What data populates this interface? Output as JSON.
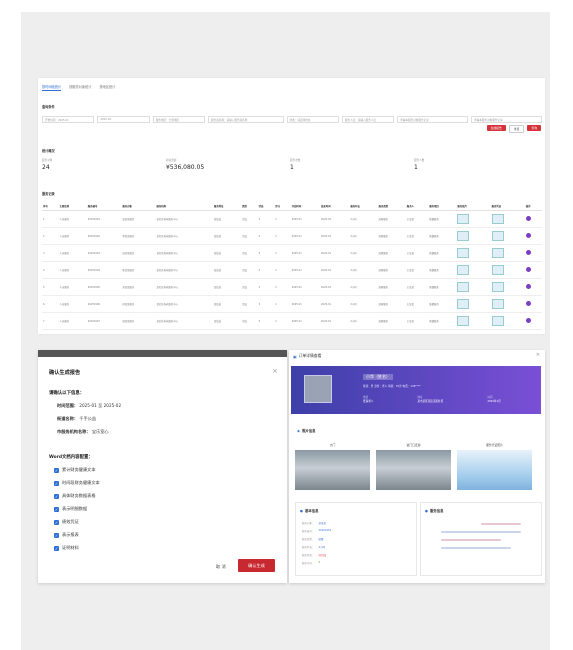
{
  "top_panel": {
    "tabs": [
      "按时间段统计",
      "按服务对象统计",
      "按地区统计"
    ],
    "section_query": "查询条件",
    "filter_fields": [
      "开始时间：2025-01",
      "2025-02",
      "服务地区：全部地区",
      "服务商名称：请输入服务商名称",
      "状态：请选择状态",
      "服务人员：请输入服务人员",
      "查看本服务对象服务记录",
      "查看本服务对象服务记录"
    ],
    "buttons": [
      "生成报告",
      "重置",
      "查询"
    ],
    "section_stats": "统计概况",
    "stats": [
      {
        "key": "服务对象",
        "value": "24"
      },
      {
        "key": "补贴金额",
        "value": "¥536,080.05"
      },
      {
        "key": "服务次数",
        "value": "1"
      },
      {
        "key": "服务人数",
        "value": "1"
      }
    ],
    "section_list": "服务记录",
    "table_headers": [
      "序号",
      "主题名称",
      "服务编号",
      "服务对象",
      "服务机构",
      "服务地址",
      "类型",
      "状态",
      "评分",
      "开始时间",
      "结束时间",
      "服务时长",
      "服务类型",
      "服务人",
      "服务项目",
      "服务照片",
      "服务凭证",
      "操作"
    ],
    "table_rows": [
      [
        "1",
        "人员服务",
        "20250101",
        "张某某服务",
        "某社区养老服务中心",
        "某街道",
        "完成",
        "5",
        "1",
        "2025-01",
        "2025-01",
        "2小时",
        "居家服务",
        "王某某",
        "助餐服务"
      ],
      [
        "2",
        "人员服务",
        "20250102",
        "李某某服务",
        "某社区养老服务中心",
        "某街道",
        "完成",
        "5",
        "1",
        "2025-01",
        "2025-01",
        "2小时",
        "居家服务",
        "王某某",
        "助餐服务"
      ],
      [
        "3",
        "人员服务",
        "20250103",
        "赵某某服务",
        "某社区养老服务中心",
        "某街道",
        "完成",
        "5",
        "1",
        "2025-01",
        "2025-01",
        "2小时",
        "居家服务",
        "王某某",
        "助餐服务"
      ],
      [
        "4",
        "人员服务",
        "20250104",
        "陈某某服务",
        "某社区养老服务中心",
        "某街道",
        "完成",
        "5",
        "1",
        "2025-01",
        "2025-01",
        "2小时",
        "居家服务",
        "王某某",
        "助餐服务"
      ],
      [
        "5",
        "人员服务",
        "20250105",
        "刘某某服务",
        "某社区养老服务中心",
        "某街道",
        "完成",
        "5",
        "1",
        "2025-01",
        "2025-01",
        "2小时",
        "居家服务",
        "王某某",
        "助餐服务"
      ],
      [
        "6",
        "人员服务",
        "20250106",
        "孙某某服务",
        "某社区养老服务中心",
        "某街道",
        "完成",
        "5",
        "1",
        "2025-01",
        "2025-01",
        "2小时",
        "居家服务",
        "王某某",
        "助餐服务"
      ],
      [
        "7",
        "人员服务",
        "20250107",
        "周某某服务",
        "某社区养老服务中心",
        "某街道",
        "完成",
        "5",
        "1",
        "2025-01",
        "2025-01",
        "2小时",
        "居家服务",
        "王某某",
        "助餐服务"
      ]
    ]
  },
  "modal": {
    "title": "确认生成报告",
    "intro": "请确认以下信息：",
    "period_label": "时间范围：",
    "period_value": "2025-01 至 2025-02",
    "street_label": "街道名称：",
    "street_value": "千手公益",
    "org_label": "市服务机构名称：",
    "org_value": "宝乐室心",
    "config_label": "Word文档内容配置：",
    "options": [
      "累计财务健康文本",
      "时间段财务健康文本",
      "具体财务数据表格",
      "表示明细数据",
      "绩效凭证",
      "表示报表",
      "证明材料"
    ],
    "cancel": "取 消",
    "confirm": "确认生成"
  },
  "detail": {
    "title": "订单详情查看",
    "name_tag": "小华（姓名）",
    "info_line": "性别：男  身份：老人  年龄：78岁  电话：138****",
    "cols": [
      {
        "key": "类别",
        "value": "低保老人"
      },
      {
        "key": "地址",
        "value": "某市某区某街道某社区"
      },
      {
        "key": "时间",
        "value": "2025年1月"
      }
    ],
    "section_photos": "照片信息",
    "photos": [
      "大门",
      "进门口走廊",
      "服务凭证照片"
    ],
    "section_basic": "基本信息",
    "section_service": "服务信息",
    "basic_kv": [
      {
        "k": "服务对象：",
        "v": "某某某"
      },
      {
        "k": "服务编号：",
        "v": "20250101"
      },
      {
        "k": "服务类型：",
        "v": "助餐"
      },
      {
        "k": "服务时长：",
        "v": "2小时"
      },
      {
        "k": "服务状态：",
        "v": "已完成"
      },
      {
        "k": "服务评分：",
        "v": "5"
      }
    ]
  }
}
